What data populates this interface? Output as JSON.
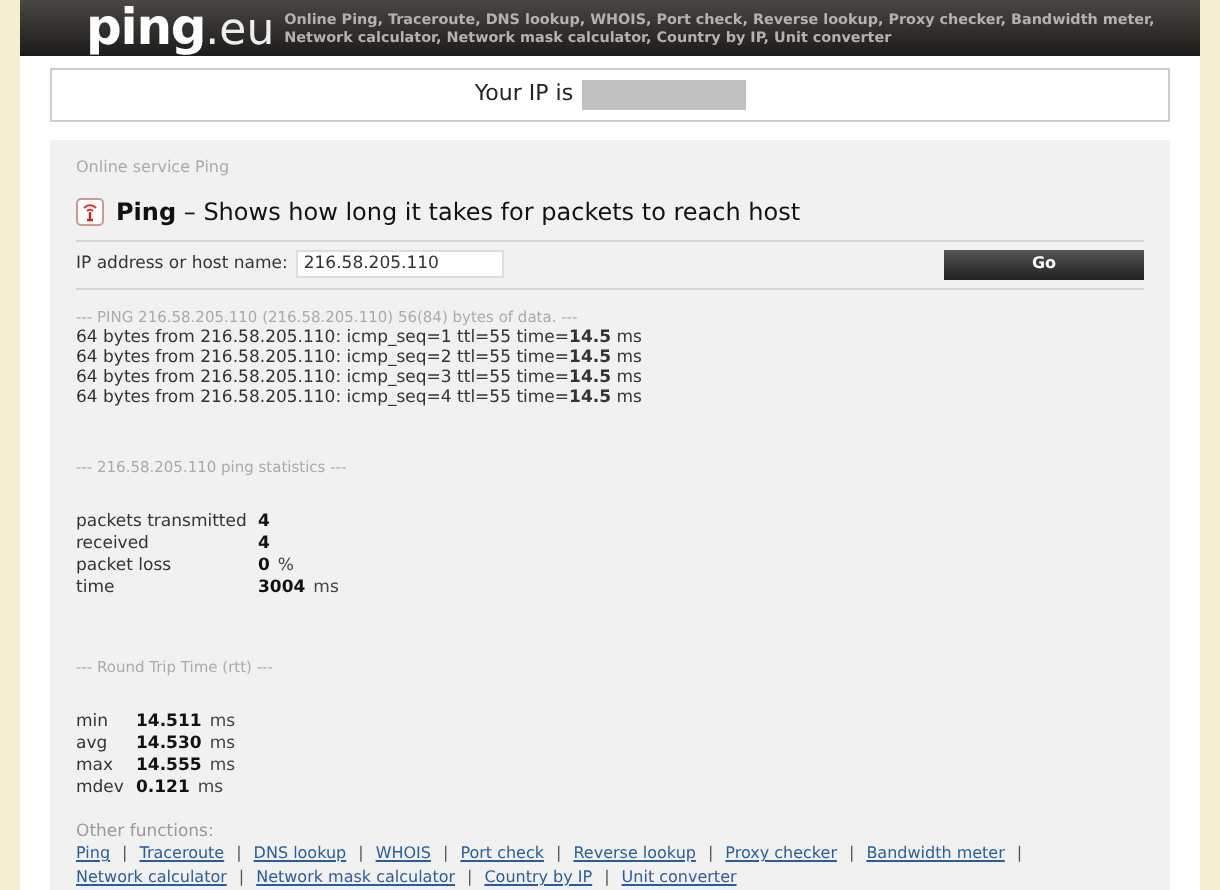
{
  "header": {
    "logo_main": "ping",
    "logo_suffix": ".eu",
    "nav_text": "Online Ping, Traceroute, DNS lookup, WHOIS, Port check, Reverse lookup, Proxy checker, Bandwidth meter, Network calculator, Network mask calculator, Country by IP, Unit converter"
  },
  "ip_box": {
    "label": "Your IP is",
    "redacted": true
  },
  "breadcrumb": "Online service Ping",
  "title": {
    "name": "Ping",
    "description": "– Shows how long it takes for packets to reach host"
  },
  "form": {
    "label": "IP address or host name:",
    "value": "216.58.205.110",
    "button": "Go"
  },
  "output": {
    "header": "--- PING 216.58.205.110 (216.58.205.110) 56(84) bytes of data. ---",
    "lines": [
      "64 bytes from 216.58.205.110: icmp_seq=1 ttl=55 time=**14.5** ms",
      "64 bytes from 216.58.205.110: icmp_seq=2 ttl=55 time=**14.5** ms",
      "64 bytes from 216.58.205.110: icmp_seq=3 ttl=55 time=**14.5** ms",
      "64 bytes from 216.58.205.110: icmp_seq=4 ttl=55 time=**14.5** ms"
    ]
  },
  "statistics": {
    "header": "--- 216.58.205.110 ping statistics ---",
    "rows": [
      {
        "label": "packets transmitted",
        "value": "4"
      },
      {
        "label": "received",
        "value": "4"
      },
      {
        "label": "packet loss",
        "value": "0",
        "unit": "%"
      },
      {
        "label": "time",
        "value": "3004",
        "unit": "ms"
      }
    ]
  },
  "rtt": {
    "header": "--- Round Trip Time (rtt) ---",
    "rows": [
      {
        "label": "min",
        "value": "14.511",
        "unit": "ms"
      },
      {
        "label": "avg",
        "value": "14.530",
        "unit": "ms"
      },
      {
        "label": "max",
        "value": "14.555",
        "unit": "ms"
      },
      {
        "label": "mdev",
        "value": "0.121",
        "unit": "ms"
      }
    ]
  },
  "other_functions": {
    "label": "Other functions:",
    "separator": "|",
    "links": [
      "Ping",
      "Traceroute",
      "DNS lookup",
      "WHOIS",
      "Port check",
      "Reverse lookup",
      "Proxy checker",
      "Bandwidth meter",
      "Network calculator",
      "Network mask calculator",
      "Country by IP",
      "Unit converter"
    ]
  }
}
